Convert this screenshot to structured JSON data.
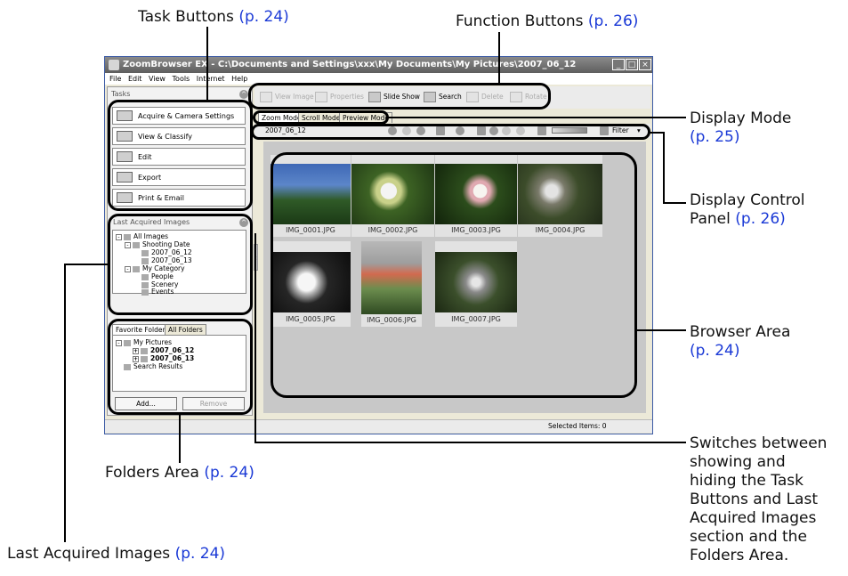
{
  "window": {
    "title": "ZoomBrowser EX  - C:\\Documents and Settings\\xxx\\My Documents\\My Pictures\\2007_06_12",
    "controls": [
      "_",
      "□",
      "×"
    ],
    "menu": [
      "File",
      "Edit",
      "View",
      "Tools",
      "Internet",
      "Help"
    ]
  },
  "tasks": {
    "title": "Tasks",
    "buttons": [
      {
        "label": "Acquire & Camera Settings",
        "icon": "camera-icon"
      },
      {
        "label": "View & Classify",
        "icon": "book-icon"
      },
      {
        "label": "Edit",
        "icon": "pencil-icon"
      },
      {
        "label": "Export",
        "icon": "export-icon"
      },
      {
        "label": "Print & Email",
        "icon": "printer-icon"
      }
    ]
  },
  "last_acquired": {
    "title": "Last Acquired Images",
    "tree": [
      "All Images",
      "Shooting Date",
      "2007_06_12",
      "2007_06_13",
      "My Category",
      "People",
      "Scenery",
      "Events"
    ]
  },
  "folders": {
    "tabs": [
      "Favorite Folders",
      "All Folders"
    ],
    "tree": [
      "My Pictures",
      "2007_06_12",
      "2007_06_13",
      "Search Results"
    ],
    "add": "Add...",
    "remove": "Remove"
  },
  "function_buttons": [
    "View Image",
    "Properties",
    "Slide Show",
    "Search",
    "Delete",
    "Rotate"
  ],
  "display_modes": [
    "Zoom Mode",
    "Scroll Mode",
    "Preview Mode"
  ],
  "control_panel": {
    "folder": "2007_06_12",
    "filter": "Filter"
  },
  "images": [
    "IMG_0001.JPG",
    "IMG_0002.JPG",
    "IMG_0003.JPG",
    "IMG_0004.JPG",
    "IMG_0005.JPG",
    "IMG_0006.JPG",
    "IMG_0007.JPG"
  ],
  "status": {
    "selected": "Selected Items: 0"
  },
  "callouts": {
    "task_buttons": {
      "text": "Task Buttons",
      "ref": "(p. 24)"
    },
    "function_buttons": {
      "text": "Function Buttons",
      "ref": "(p. 26)"
    },
    "display_mode": {
      "text": "Display Mode",
      "ref": "(p. 25)"
    },
    "display_control": {
      "text1": "Display Control",
      "text2": "Panel",
      "ref": "(p. 26)"
    },
    "browser_area": {
      "text": "Browser Area",
      "ref": "(p. 24)"
    },
    "switches": [
      "Switches between",
      "showing and",
      "hiding the Task",
      "Buttons and Last",
      "Acquired Images",
      "section and the",
      "Folders Area."
    ],
    "folders_area": {
      "text": "Folders Area",
      "ref": "(p. 24)"
    },
    "last_acquired": {
      "text": "Last Acquired Images",
      "ref": "(p. 24)"
    }
  },
  "colors": {
    "reference_link": "#1a39d6",
    "titlebar": "#6b6b6b",
    "browser_bg": "#c8c8c8"
  }
}
